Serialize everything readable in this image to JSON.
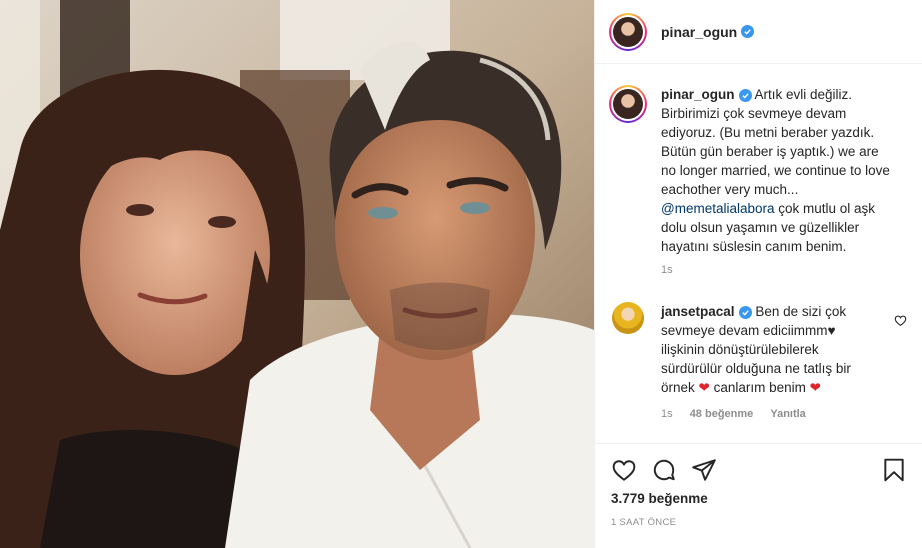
{
  "post": {
    "author": {
      "username": "pinar_ogun",
      "verified": true
    },
    "caption": {
      "username": "pinar_ogun",
      "text_before_mention": "Artık evli değiliz. Birbirimizi çok sevmeye devam ediyoruz. (Bu metni beraber yazdık. Bütün gün beraber iş yaptık.) we are no longer married, we continue to love eachother very much...",
      "mention": "@memetalialabora",
      "text_after_mention": " çok mutlu ol aşk dolu olsun yaşamın ve güzellikler hayatını süslesin canım benim.",
      "time": "1s"
    },
    "comments": [
      {
        "username": "jansetpacal",
        "verified": true,
        "text_part1": "Ben de sizi çok sevmeye devam ediciimmm♥ ilişkinin dönüştürülebilerek sürdürülür olduğuna ne tatlış bir örnek",
        "heart1": "❤",
        "text_part2": " canlarım benim",
        "heart2": "❤",
        "time": "1s",
        "likes": "48 beğenme",
        "reply_label": "Yanıtla"
      }
    ],
    "likes_count": "3.779 beğenme",
    "posted_ago": "1 SAAT ÖNCE",
    "icons": {
      "like": "heart-outline-icon",
      "comment": "speech-bubble-icon",
      "share": "paper-plane-icon",
      "save": "bookmark-icon",
      "verified": "verified-badge-icon"
    },
    "colors": {
      "verified_blue": "#3897f0",
      "mention_blue": "#00376b",
      "heart_red": "#e0242e",
      "muted_gray": "#8e8e8e"
    }
  }
}
